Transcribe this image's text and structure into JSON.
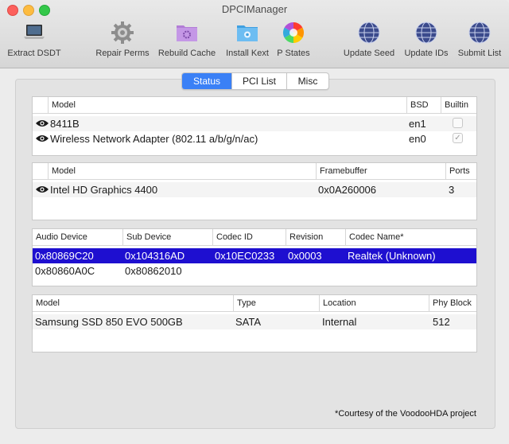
{
  "window": {
    "title": "DPCIManager"
  },
  "toolbar": [
    {
      "label": "Extract DSDT",
      "icon": "laptop-icon"
    },
    {
      "label": "Repair Perms",
      "icon": "gear-icon"
    },
    {
      "label": "Rebuild Cache",
      "icon": "folder-gear-icon"
    },
    {
      "label": "Install Kext",
      "icon": "folder-kext-icon"
    },
    {
      "label": "P States",
      "icon": "color-wheel-icon"
    },
    {
      "label": "Update Seed",
      "icon": "globe-icon"
    },
    {
      "label": "Update IDs",
      "icon": "globe-icon"
    },
    {
      "label": "Submit List",
      "icon": "globe-icon"
    }
  ],
  "tabs": {
    "status": "Status",
    "pci_list": "PCI List",
    "misc": "Misc",
    "selected": "Status"
  },
  "network": {
    "headers": [
      "Model",
      "BSD",
      "Builtin"
    ],
    "rows": [
      {
        "model": "8411B",
        "bsd": "en1",
        "builtin": false
      },
      {
        "model": "Wireless Network Adapter (802.11 a/b/g/n/ac)",
        "bsd": "en0",
        "builtin": true
      }
    ]
  },
  "graphics": {
    "headers": [
      "Model",
      "Framebuffer",
      "Ports"
    ],
    "rows": [
      {
        "model": "Intel HD Graphics 4400",
        "framebuffer": "0x0A260006",
        "ports": "3"
      }
    ]
  },
  "audio": {
    "headers": [
      "Audio Device",
      "Sub Device",
      "Codec ID",
      "Revision",
      "Codec Name*"
    ],
    "rows": [
      {
        "device": "0x80869C20",
        "sub": "0x104316AD",
        "codec_id": "0x10EC0233",
        "revision": "0x0003",
        "codec_name": "Realtek (Unknown)"
      },
      {
        "device": "0x80860A0C",
        "sub": "0x80862010",
        "codec_id": "",
        "revision": "",
        "codec_name": ""
      }
    ]
  },
  "storage": {
    "headers": [
      "Model",
      "Type",
      "Location",
      "Phy Block"
    ],
    "rows": [
      {
        "model": "Samsung SSD 850 EVO 500GB",
        "type": "SATA",
        "location": "Internal",
        "phy_block": "512"
      }
    ]
  },
  "footer": "*Courtesy of the VoodooHDA project",
  "colors": {
    "selection": "#1e0fd0",
    "tab_active": "#3a80f6"
  }
}
